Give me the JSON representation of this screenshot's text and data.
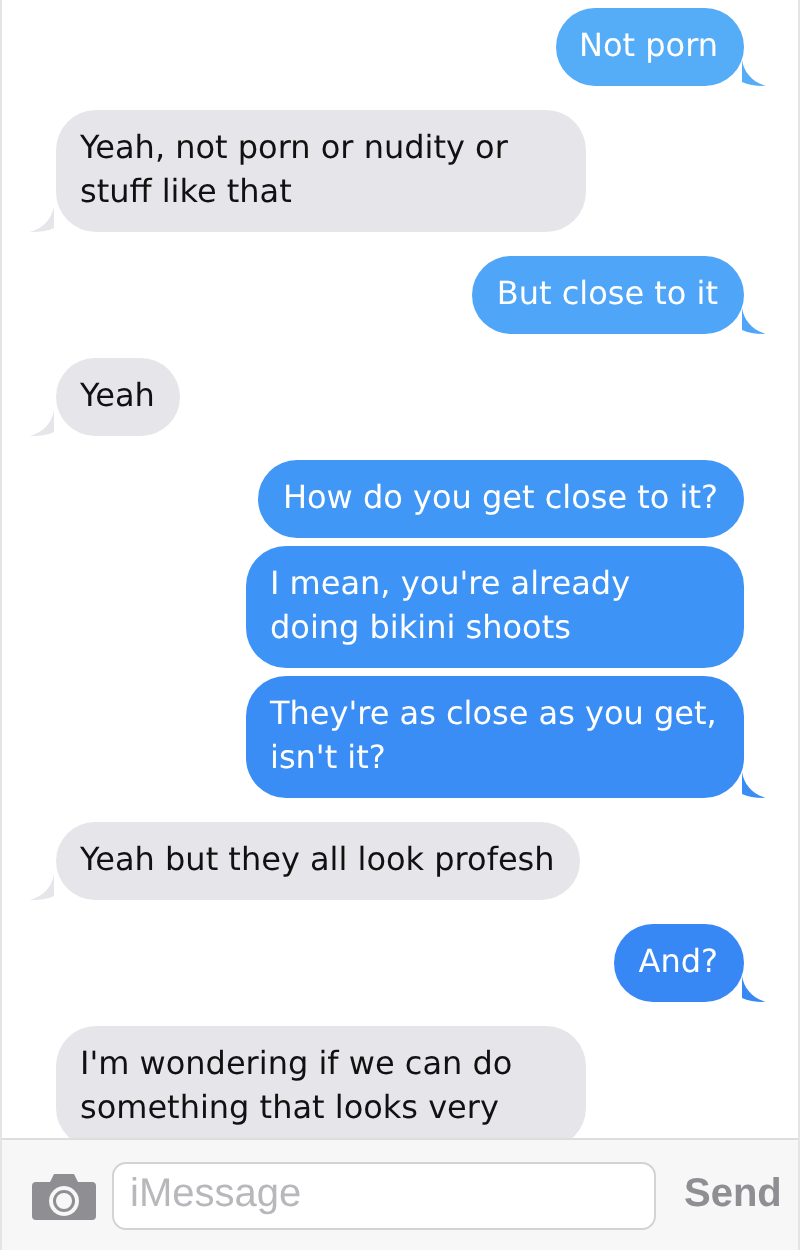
{
  "messages": [
    {
      "kind": "sent",
      "text": "Not porn",
      "color": "#55acf7",
      "tail": true
    },
    {
      "kind": "received",
      "text": "Yeah, not porn or nudity or stuff like that",
      "tail": true
    },
    {
      "kind": "sent",
      "text": "But close to it",
      "color": "#4fa5f7",
      "tail": true
    },
    {
      "kind": "received",
      "text": "Yeah",
      "tail": true
    },
    {
      "kind": "sent",
      "text": "How do you get close to it?",
      "color": "#4197f6",
      "tail": false
    },
    {
      "kind": "sent",
      "text": "I mean, you're already doing bikini shoots",
      "color": "#3e93f6",
      "tail": false
    },
    {
      "kind": "sent",
      "text": "They're as close as you get, isn't it?",
      "color": "#3a8df5",
      "tail": true
    },
    {
      "kind": "received",
      "text": "Yeah but they all look profesh",
      "tail": true
    },
    {
      "kind": "sent",
      "text": "And?",
      "color": "#3788f5",
      "tail": true
    },
    {
      "kind": "received",
      "text": "I'm wondering if we can do something that looks very",
      "tail": false
    }
  ],
  "composer": {
    "placeholder": "iMessage",
    "send": "Send"
  }
}
